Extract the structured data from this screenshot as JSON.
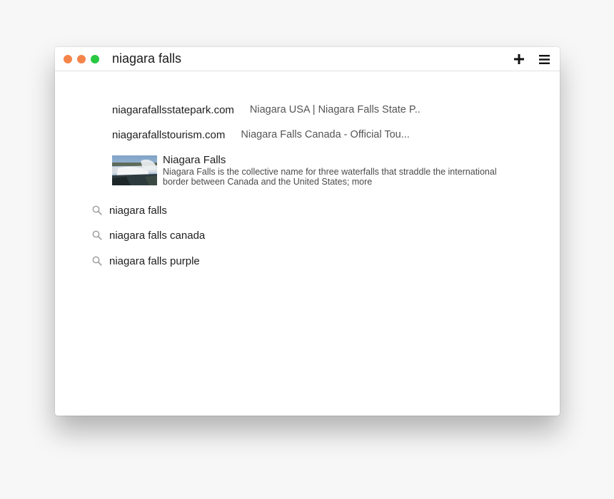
{
  "window": {
    "traffic_lights": [
      {
        "name": "close",
        "color": "#f4854a"
      },
      {
        "name": "minimize",
        "color": "#f4854a"
      },
      {
        "name": "zoom",
        "color": "#28c941"
      }
    ],
    "search_value": "niagara falls",
    "icons": {
      "add": "plus-icon",
      "menu": "hamburger-menu-icon"
    }
  },
  "results": {
    "urls": [
      {
        "domain": "niagarafallsstatepark.com",
        "description": "Niagara USA | Niagara Falls State P.."
      },
      {
        "domain": "niagarafallstourism.com",
        "description": "Niagara Falls Canada - Official Tou..."
      }
    ],
    "wiki": {
      "title": "Niagara Falls",
      "description": "Niagara Falls is the collective name for three waterfalls that straddle the international border between Canada and the United States; more",
      "thumbnail_icon": "waterfall-thumbnail"
    },
    "suggestions": [
      {
        "label": "niagara falls",
        "icon": "search-icon"
      },
      {
        "label": "niagara falls canada",
        "icon": "search-icon"
      },
      {
        "label": "niagara falls purple",
        "icon": "search-icon"
      }
    ]
  }
}
